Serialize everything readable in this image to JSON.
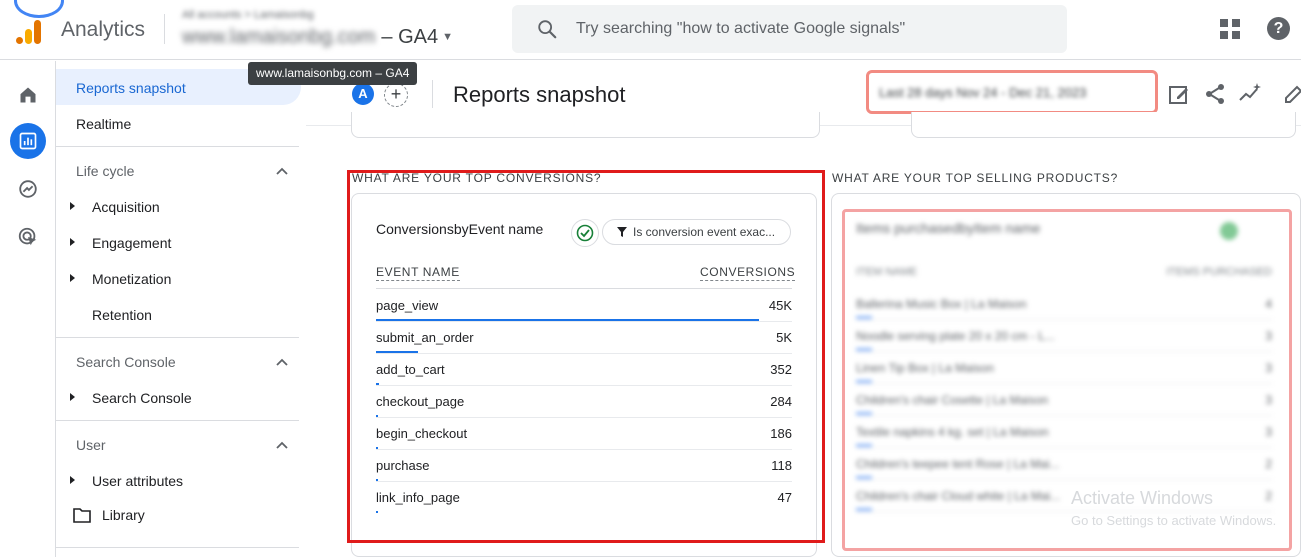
{
  "app": {
    "name": "Analytics",
    "account_label": "All accounts > Lamaisonbg",
    "property_name": "www.lamaisonbg.com",
    "property_suffix": "– GA4",
    "tooltip": "www.lamaisonbg.com – GA4"
  },
  "search": {
    "placeholder": "Try searching \"how to activate Google signals\""
  },
  "rail": [
    "home-icon",
    "reports-icon",
    "explore-icon",
    "advertising-icon"
  ],
  "sidebar": {
    "active_item": "Reports snapshot",
    "realtime": "Realtime",
    "sections": [
      {
        "title": "Life cycle",
        "items": [
          "Acquisition",
          "Engagement",
          "Monetization",
          "Retention"
        ]
      },
      {
        "title": "Search Console",
        "items": [
          "Search Console"
        ]
      },
      {
        "title": "User",
        "items": [
          "User attributes",
          "Library"
        ]
      }
    ]
  },
  "header": {
    "comparison_avatar": "A",
    "add_comparison": "+",
    "title": "Reports snapshot",
    "date_range": "Last 28 days  Nov 24 - Dec 21, 2023"
  },
  "conversions_section": {
    "title": "WHAT ARE YOUR TOP CONVERSIONS?",
    "card_title": "ConversionsbyEvent name",
    "filter_chip": "Is conversion event exac...",
    "col_event": "EVENT NAME",
    "col_conversions": "CONVERSIONS",
    "rows": [
      {
        "event": "page_view",
        "conversions": "45K",
        "share": 0.92
      },
      {
        "event": "submit_an_order",
        "conversions": "5K",
        "share": 0.1
      },
      {
        "event": "add_to_cart",
        "conversions": "352",
        "share": 0.008
      },
      {
        "event": "checkout_page",
        "conversions": "284",
        "share": 0.006
      },
      {
        "event": "begin_checkout",
        "conversions": "186",
        "share": 0.004
      },
      {
        "event": "purchase",
        "conversions": "118",
        "share": 0.003
      },
      {
        "event": "link_info_page",
        "conversions": "47",
        "share": 0.002
      }
    ]
  },
  "products_section": {
    "title": "WHAT ARE YOUR TOP SELLING PRODUCTS?",
    "card_title": "Items purchasedbyItem name",
    "col_item": "ITEM NAME",
    "col_purchased": "ITEMS PURCHASED",
    "rows": [
      {
        "item": "Ballerina Music Box | La Maison",
        "value": "4"
      },
      {
        "item": "Noodle serving plate 20 x 20 cm - L...",
        "value": "3"
      },
      {
        "item": "Linen Tip Box | La Maison",
        "value": "3"
      },
      {
        "item": "Children's chair Cosette | La Maison",
        "value": "3"
      },
      {
        "item": "Textile napkins 4 kg. set | La Maison",
        "value": "3"
      },
      {
        "item": "Children's teepee tent Rose | La Mai...",
        "value": "2"
      },
      {
        "item": "Children's chair Cloud white | La Mai...",
        "value": "2"
      }
    ]
  },
  "watermark": {
    "line1": "Activate Windows",
    "line2": "Go to Settings to activate Windows."
  },
  "colors": {
    "accent": "#1a73e8",
    "highlight_red": "#e01b1b"
  }
}
